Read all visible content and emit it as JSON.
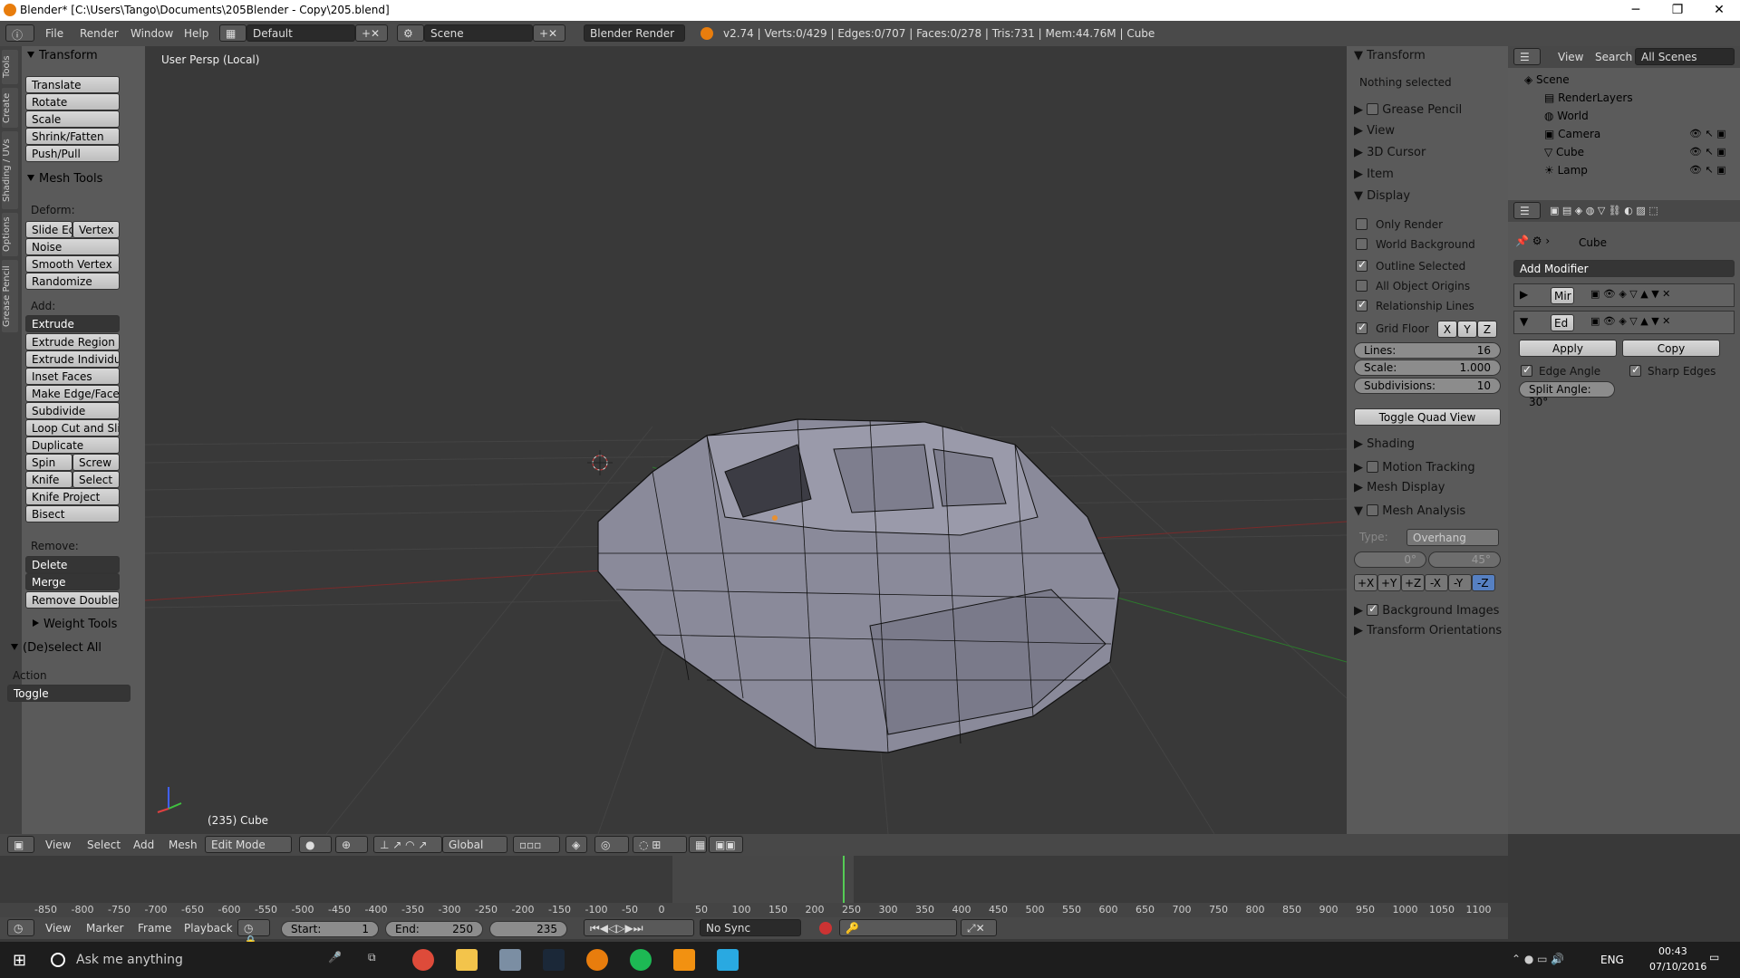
{
  "window": {
    "title": "Blender* [C:\\Users\\Tango\\Documents\\205Blender - Copy\\205.blend]",
    "minimize": "─",
    "maximize": "❐",
    "close": "✕"
  },
  "info": {
    "menus": [
      "File",
      "Render",
      "Window",
      "Help"
    ],
    "layout": "Default",
    "scene": "Scene",
    "engine": "Blender Render",
    "stats": "v2.74 | Verts:0/429 | Edges:0/707 | Faces:0/278 | Tris:731 | Mem:44.76M | Cube"
  },
  "left_tabs": [
    "Tools",
    "Create",
    "Shading / UVs",
    "Options",
    "Grease Pencil"
  ],
  "toolshelf": {
    "transform_header": "Transform",
    "transform": [
      "Translate",
      "Rotate",
      "Scale",
      "Shrink/Fatten",
      "Push/Pull"
    ],
    "mesh_tools_header": "Mesh Tools",
    "deform_label": "Deform:",
    "slide_edge": "Slide Ed",
    "vertex": "Vertex",
    "deform": [
      "Noise",
      "Smooth Vertex",
      "Randomize"
    ],
    "add_label": "Add:",
    "extrude": "Extrude",
    "add": [
      "Extrude Region",
      "Extrude Individual",
      "Inset Faces",
      "Make Edge/Face",
      "Subdivide",
      "Loop Cut and Sli...",
      "Duplicate"
    ],
    "spin": "Spin",
    "screw": "Screw",
    "knife": "Knife",
    "select": "Select",
    "add2": [
      "Knife Project",
      "Bisect"
    ],
    "remove_label": "Remove:",
    "delete": "Delete",
    "merge": "Merge",
    "remove_doubles": "Remove Doubles",
    "weight_tools": "Weight Tools",
    "deselect_header": "(De)select All",
    "action_label": "Action",
    "action_value": "Toggle"
  },
  "viewport": {
    "label": "User Persp (Local)",
    "object_label": "(235) Cube"
  },
  "npanel": {
    "transform": "Transform",
    "nothing_selected": "Nothing selected",
    "grease_pencil": "Grease Pencil",
    "view": "View",
    "cursor": "3D Cursor",
    "item": "Item",
    "display": "Display",
    "only_render": "Only Render",
    "world_background": "World Background",
    "outline_selected": "Outline Selected",
    "all_origins": "All Object Origins",
    "relationship_lines": "Relationship Lines",
    "grid_floor": "Grid Floor",
    "x": "X",
    "y": "Y",
    "z": "Z",
    "lines_label": "Lines:",
    "lines_value": "16",
    "scale_label": "Scale:",
    "scale_value": "1.000",
    "subdiv_label": "Subdivisions:",
    "subdiv_value": "10",
    "toggle_quad": "Toggle Quad View",
    "shading": "Shading",
    "motion_tracking": "Motion Tracking",
    "mesh_display": "Mesh Display",
    "mesh_analysis": "Mesh Analysis",
    "type_label": "Type:",
    "type_value": "Overhang",
    "angle_min": "0°",
    "angle_max": "45°",
    "axes": [
      "+X",
      "+Y",
      "+Z",
      "-X",
      "-Y",
      "-Z"
    ],
    "background_images": "Background Images",
    "transform_orientations": "Transform Orientations"
  },
  "outliner": {
    "menus": [
      "View",
      "Search"
    ],
    "filter": "All Scenes",
    "items": [
      "Scene",
      "RenderLayers",
      "World",
      "Camera",
      "Cube",
      "Lamp"
    ]
  },
  "properties": {
    "object": "Cube",
    "add_modifier": "Add Modifier",
    "mod1": "Mir",
    "mod2": "Ed",
    "apply": "Apply",
    "copy": "Copy",
    "edge_angle": "Edge Angle",
    "sharp_edges": "Sharp Edges",
    "split_angle": "Split Angle: 30°"
  },
  "vp_header": {
    "menus": [
      "View",
      "Select",
      "Add",
      "Mesh"
    ],
    "mode": "Edit Mode",
    "orientation": "Global"
  },
  "timeline": {
    "ticks": [
      "-850",
      "-800",
      "-750",
      "-700",
      "-650",
      "-600",
      "-550",
      "-500",
      "-450",
      "-400",
      "-350",
      "-300",
      "-250",
      "-200",
      "-150",
      "-100",
      "-50",
      "0",
      "50",
      "100",
      "150",
      "200",
      "250",
      "300",
      "350",
      "400",
      "450",
      "500",
      "550",
      "600",
      "650",
      "700",
      "750",
      "800",
      "850",
      "900",
      "950",
      "1000",
      "1050",
      "1100"
    ],
    "current": 235
  },
  "tl_header": {
    "menus": [
      "View",
      "Marker",
      "Frame",
      "Playback"
    ],
    "start_label": "Start:",
    "start": "1",
    "end_label": "End:",
    "end": "250",
    "frame": "235",
    "sync": "No Sync"
  },
  "taskbar": {
    "search": "Ask me anything",
    "lang": "ENG",
    "time": "00:43",
    "date": "07/10/2016"
  }
}
